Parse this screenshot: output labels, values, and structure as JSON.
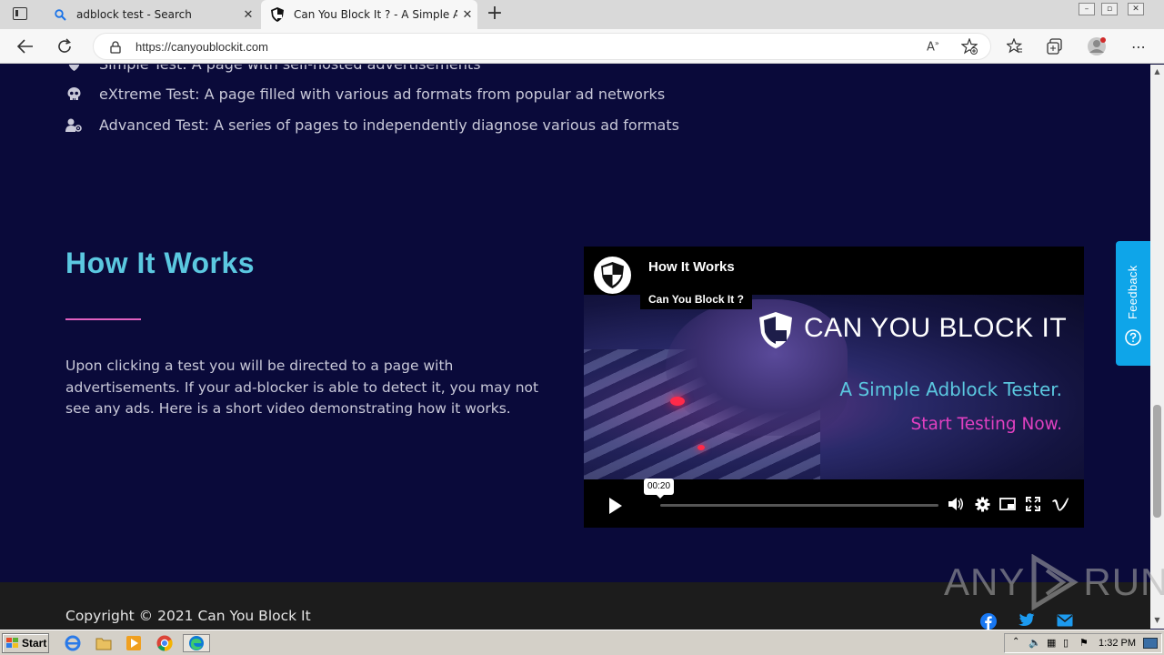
{
  "browser": {
    "tabs": [
      {
        "label": "adblock test - Search",
        "icon": "search-icon"
      },
      {
        "label": "Can You Block It ? - A Simple Ad",
        "icon": "shield-icon",
        "active": true
      }
    ],
    "url": "https://canyoublockit.com"
  },
  "tests": [
    {
      "label": "Simple Test: A page with self-hosted advertisements",
      "icon": "shield-icon"
    },
    {
      "label": "eXtreme Test: A page filled with various ad formats from popular ad networks",
      "icon": "skull-icon"
    },
    {
      "label": "Advanced Test: A series of pages to independently diagnose various ad formats",
      "icon": "user-gear-icon"
    }
  ],
  "how_it_works": {
    "title": "How It Works",
    "description": "Upon clicking a test you will be directed to a page with advertisements. If your ad-blocker is able to detect it, you may not see any ads. Here is a short video demonstrating how it works."
  },
  "video": {
    "title": "How It Works",
    "byline": "Can You Block It ?",
    "brand_name": "CAN YOU BLOCK IT",
    "tagline": "A Simple Adblock Tester.",
    "cta": "Start Testing Now.",
    "time": "00:20",
    "progress": 0
  },
  "feedback": {
    "label": "Feedback"
  },
  "footer": {
    "copyright": "Copyright © 2021 Can You Block It"
  },
  "watermark": {
    "text": "ANY RUN"
  },
  "taskbar": {
    "start_label": "Start",
    "clock": "1:32 PM"
  },
  "colors": {
    "accent": "#5bc8e0",
    "pink": "#e060c0",
    "page_bg": "#0a0a3a",
    "feedback": "#0ea5e9"
  }
}
